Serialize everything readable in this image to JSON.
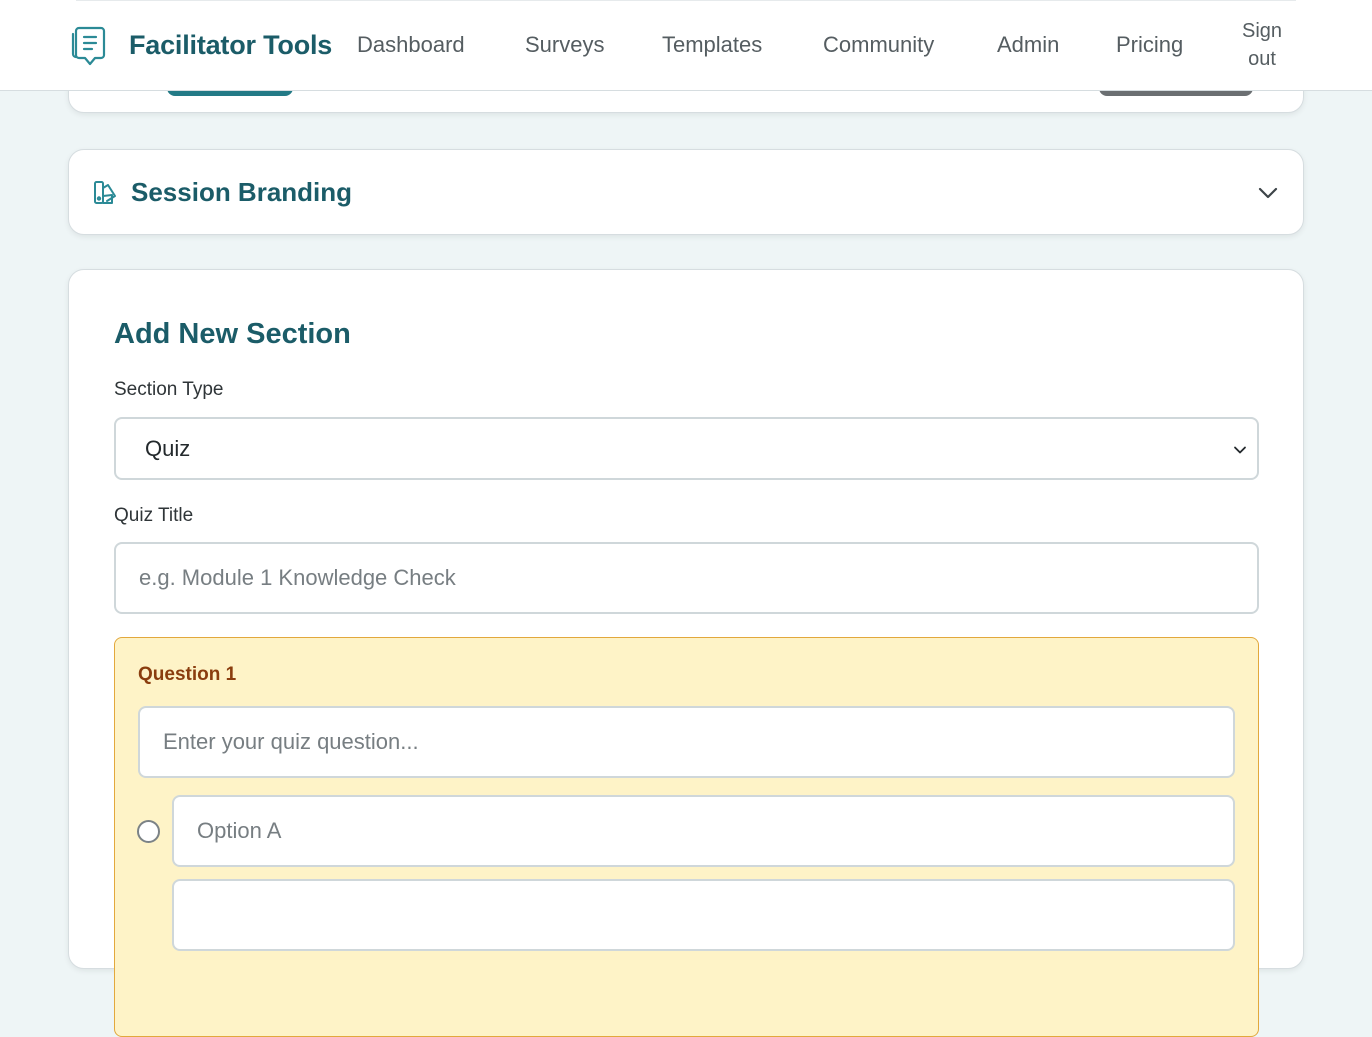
{
  "header": {
    "brand_name": "Facilitator Tools",
    "brand_icon": "feedback-document-icon",
    "nav": [
      {
        "label": "Dashboard"
      },
      {
        "label": "Surveys"
      },
      {
        "label": "Templates"
      },
      {
        "label": "Community"
      },
      {
        "label": "Admin"
      },
      {
        "label": "Pricing"
      }
    ],
    "sign_out": "Sign out"
  },
  "branding": {
    "title": "Session Branding",
    "icon": "palette-swatch-icon",
    "toggle_icon": "chevron-down-icon"
  },
  "add_section": {
    "title": "Add New Section",
    "section_type_label": "Section Type",
    "section_type_value": "Quiz",
    "quiz_title_label": "Quiz Title",
    "quiz_title_value": "",
    "quiz_title_placeholder": "e.g. Module 1 Knowledge Check",
    "question": {
      "label": "Question 1",
      "value": "",
      "placeholder": "Enter your quiz question...",
      "options": [
        {
          "placeholder": "Option A",
          "value": "",
          "selected": false
        },
        {
          "placeholder": "",
          "value": "",
          "selected": false
        }
      ]
    }
  },
  "colors": {
    "brand": "#1b5c68",
    "accent_teal": "#237a86",
    "page_bg": "#eef5f6",
    "question_bg": "#fef3c7",
    "question_border": "#e2a83c",
    "question_label": "#8a3d0e"
  }
}
